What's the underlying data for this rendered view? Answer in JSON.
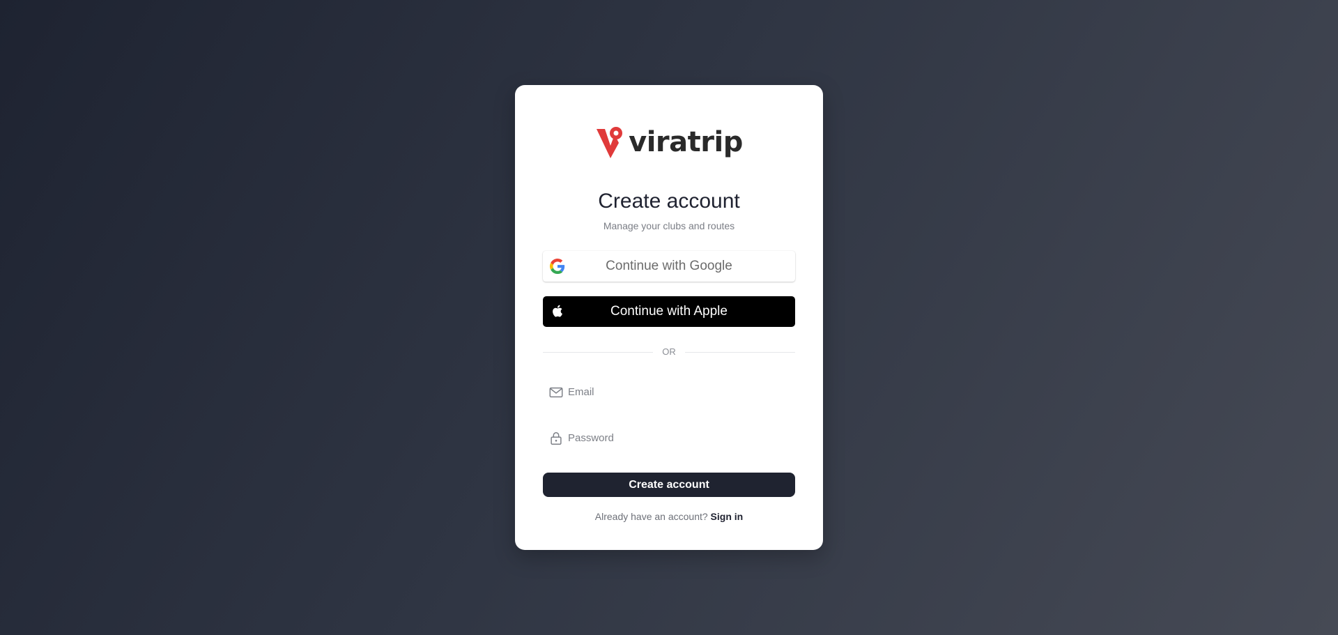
{
  "brand": {
    "name": "viratrip",
    "accent": "#e03a3a"
  },
  "header": {
    "title": "Create account",
    "subtitle": "Manage your clubs and routes"
  },
  "social": {
    "google_label": "Continue with Google",
    "google_icon": "google-icon",
    "apple_label": "Continue with Apple",
    "apple_icon": "apple-icon"
  },
  "divider": {
    "text": "OR"
  },
  "form": {
    "email": {
      "placeholder": "Email",
      "value": "",
      "icon": "mail-icon"
    },
    "password": {
      "placeholder": "Password",
      "value": "",
      "icon": "lock-icon"
    },
    "submit_label": "Create account"
  },
  "footer": {
    "prompt": "Already have an account?",
    "link_label": "Sign in"
  },
  "colors": {
    "primary_button": "#1f2330",
    "apple_button": "#000000"
  }
}
